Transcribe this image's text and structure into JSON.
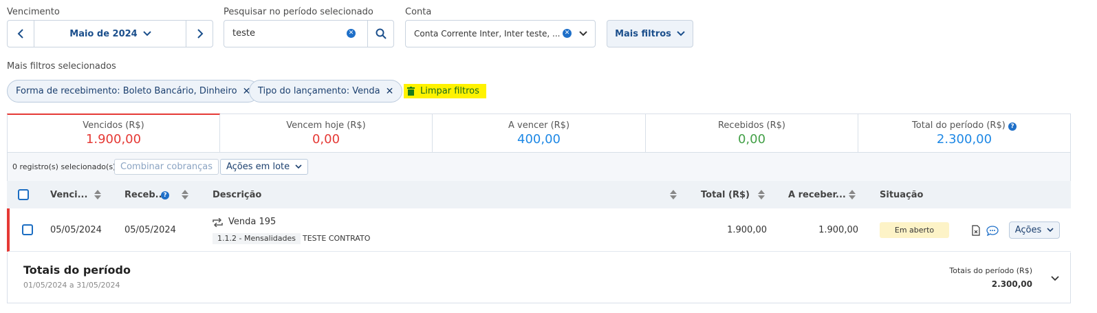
{
  "filters": {
    "vencimento_label": "Vencimento",
    "month_value": "Maio de 2024",
    "search_label": "Pesquisar no período selecionado",
    "search_value": "teste",
    "conta_label": "Conta",
    "conta_value": "Conta Corrente Inter, Inter teste, ...",
    "mais_filtros": "Mais filtros"
  },
  "selected_filters": {
    "title": "Mais filtros selecionados",
    "chips": [
      "Forma de recebimento: Boleto Bancário, Dinheiro",
      "Tipo do lançamento: Venda"
    ],
    "clear_label": "Limpar filtros"
  },
  "summary": [
    {
      "title": "Vencidos (R$)",
      "value": "1.900,00",
      "color": "#e53935"
    },
    {
      "title": "Vencem hoje (R$)",
      "value": "0,00",
      "color": "#e53935"
    },
    {
      "title": "A vencer (R$)",
      "value": "400,00",
      "color": "#1e88e5"
    },
    {
      "title": "Recebidos (R$)",
      "value": "0,00",
      "color": "#43a047"
    },
    {
      "title": "Total do período (R$)",
      "value": "2.300,00",
      "color": "#1e88e5"
    }
  ],
  "toolbar": {
    "selected_count": "0 registro(s) selecionado(s)",
    "combine_label": "Combinar cobranças",
    "batch_label": "Ações em lote"
  },
  "table": {
    "headers": {
      "venc": "Venci...",
      "receb": "Receb...",
      "desc": "Descrição",
      "total": "Total (R$)",
      "areceber": "A receber...",
      "situacao": "Situação"
    },
    "row": {
      "venc": "05/05/2024",
      "receb": "05/05/2024",
      "desc": "Venda 195",
      "category": "1.1.2 - Mensalidades",
      "contract": "TESTE CONTRATO",
      "total": "1.900,00",
      "areceber": "1.900,00",
      "status": "Em aberto",
      "actions": "Ações"
    }
  },
  "totals": {
    "title": "Totais do período",
    "range": "01/05/2024 a 31/05/2024",
    "right_label": "Totais do período (R$)",
    "right_value": "2.300,00"
  }
}
